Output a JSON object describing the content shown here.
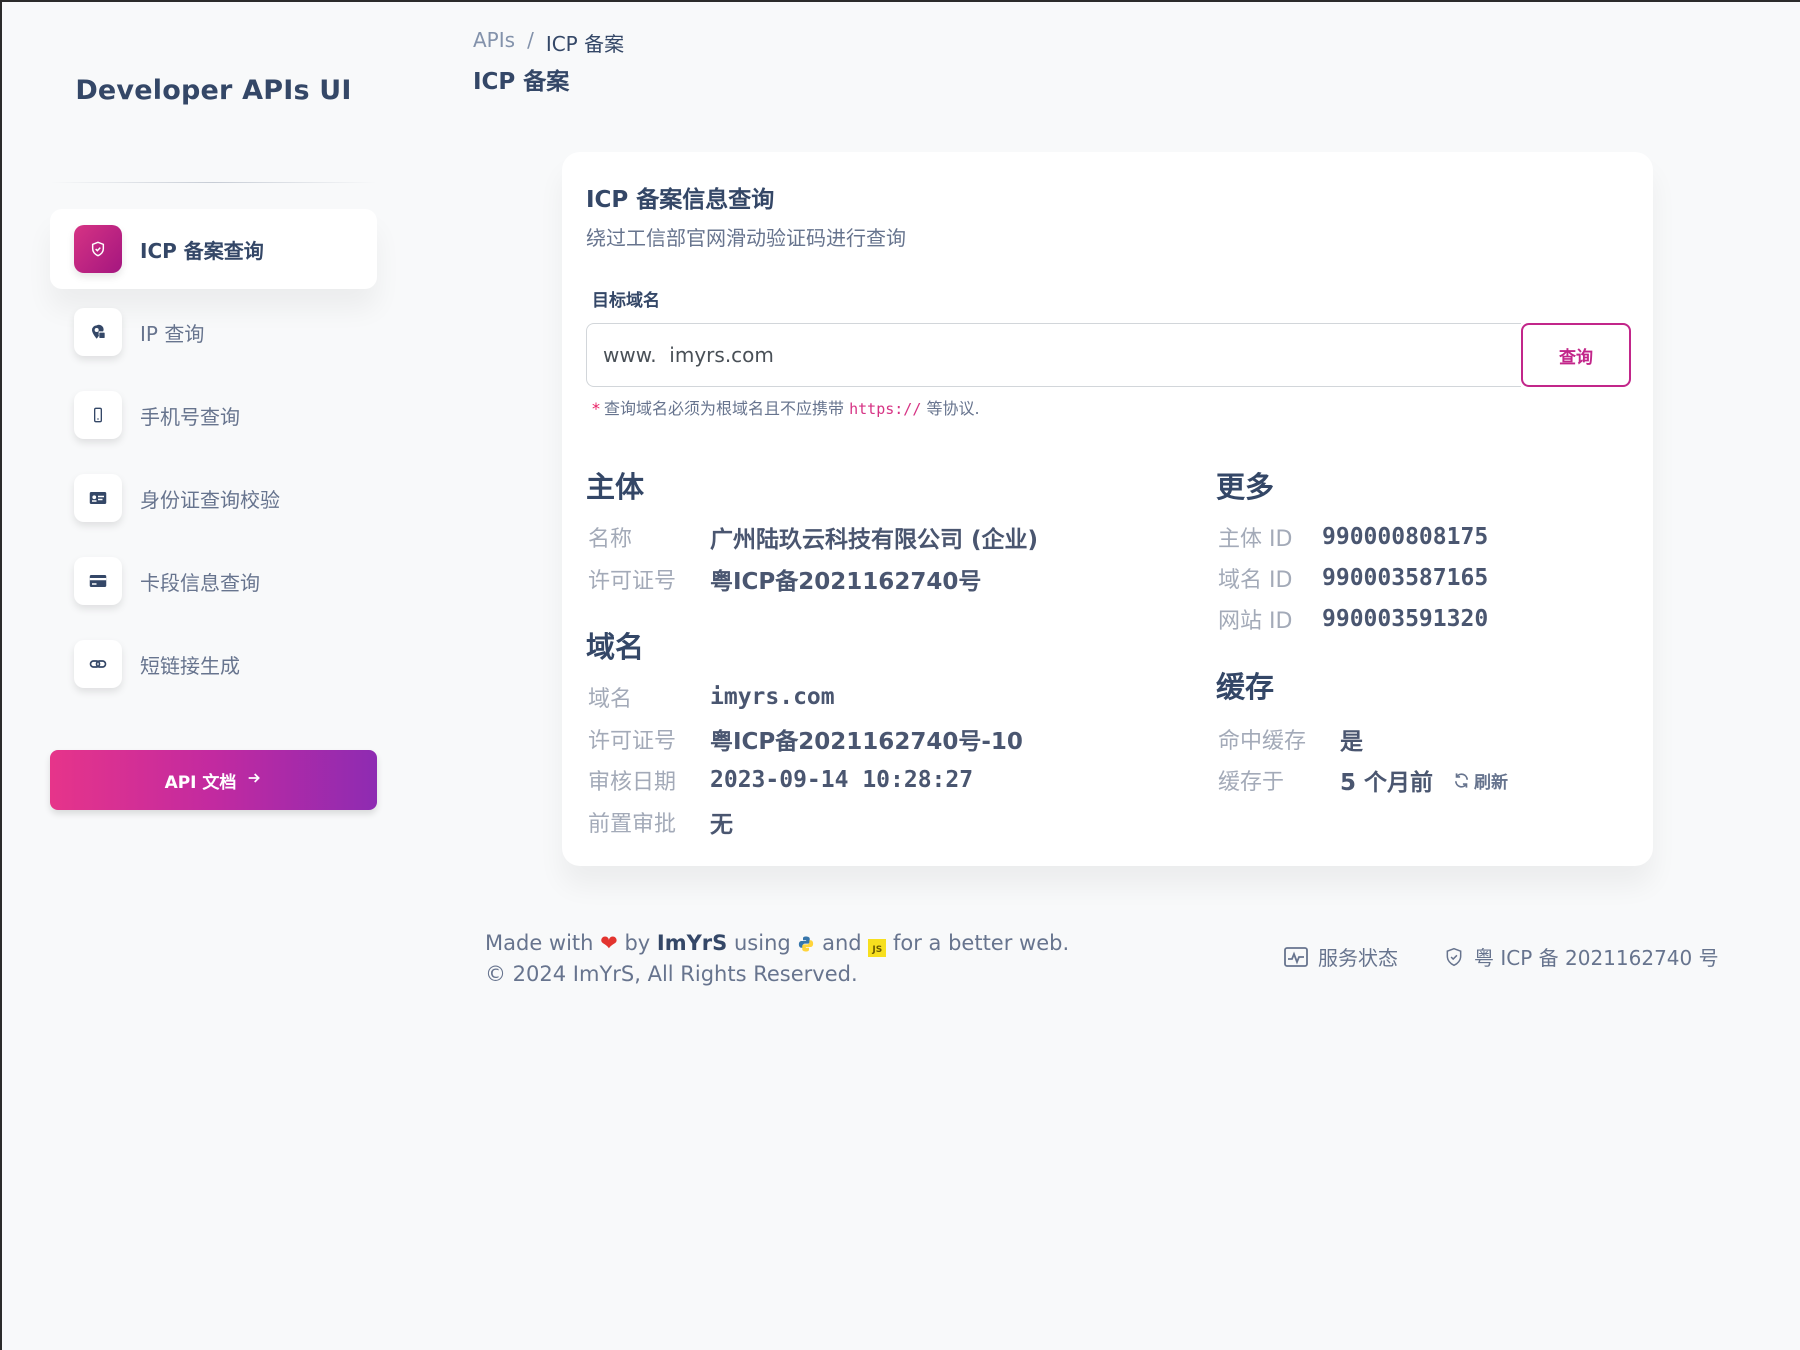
{
  "sidebar": {
    "brand": "Developer APIs UI",
    "items": [
      {
        "label": "ICP 备案查询",
        "icon": "shield-icon",
        "active": true
      },
      {
        "label": "IP 查询",
        "icon": "location-pin-icon"
      },
      {
        "label": "手机号查询",
        "icon": "mobile-phone-icon"
      },
      {
        "label": "身份证查询校验",
        "icon": "id-card-icon"
      },
      {
        "label": "卡段信息查询",
        "icon": "credit-card-icon"
      },
      {
        "label": "短链接生成",
        "icon": "link-icon"
      }
    ],
    "api_button": "API 文档"
  },
  "header": {
    "breadcrumb_root": "APIs",
    "breadcrumb_sep": "/",
    "breadcrumb_current": "ICP 备案",
    "title": "ICP 备案"
  },
  "card": {
    "title": "ICP 备案信息查询",
    "subtitle": "绕过工信部官网滑动验证码进行查询",
    "field_label": "目标域名",
    "input_value": "www.  imyrs.com",
    "query_button": "查询",
    "hint_star": "*",
    "hint_pre": "查询域名必须为根域名且不应携带",
    "hint_code": "https://",
    "hint_post": "等协议."
  },
  "subject": {
    "heading": "主体",
    "name_label": "名称",
    "name_value": "广州陆玖云科技有限公司 (企业)",
    "license_label": "许可证号",
    "license_value": "粤ICP备2021162740号"
  },
  "domain": {
    "heading": "域名",
    "domain_label": "域名",
    "domain_value": "imyrs.com",
    "license_label": "许可证号",
    "license_value": "粤ICP备2021162740号-10",
    "audit_label": "审核日期",
    "audit_value": "2023-09-14 10:28:27",
    "pre_label": "前置审批",
    "pre_value": "无"
  },
  "more": {
    "heading": "更多",
    "subject_id_label": "主体 ID",
    "subject_id_value": "990000808175",
    "domain_id_label": "域名 ID",
    "domain_id_value": "990003587165",
    "site_id_label": "网站 ID",
    "site_id_value": "990003591320"
  },
  "cache": {
    "heading": "缓存",
    "hit_label": "命中缓存",
    "hit_value": "是",
    "at_label": "缓存于",
    "at_value": "5 个月前",
    "refresh": "刷新"
  },
  "footer": {
    "made_with": "Made with",
    "by": "by",
    "author": "ImYrS",
    "using": "using",
    "and": "and",
    "tail": "for a better web.",
    "copyright": "© 2024 ImYrS, All Rights Reserved.",
    "status_link": "服务状态",
    "icp_link": "粤 ICP 备 2021162740 号",
    "js_badge": "JS"
  },
  "colors": {
    "accent": "#c2268a",
    "text": "#344767",
    "muted": "#67748e"
  }
}
